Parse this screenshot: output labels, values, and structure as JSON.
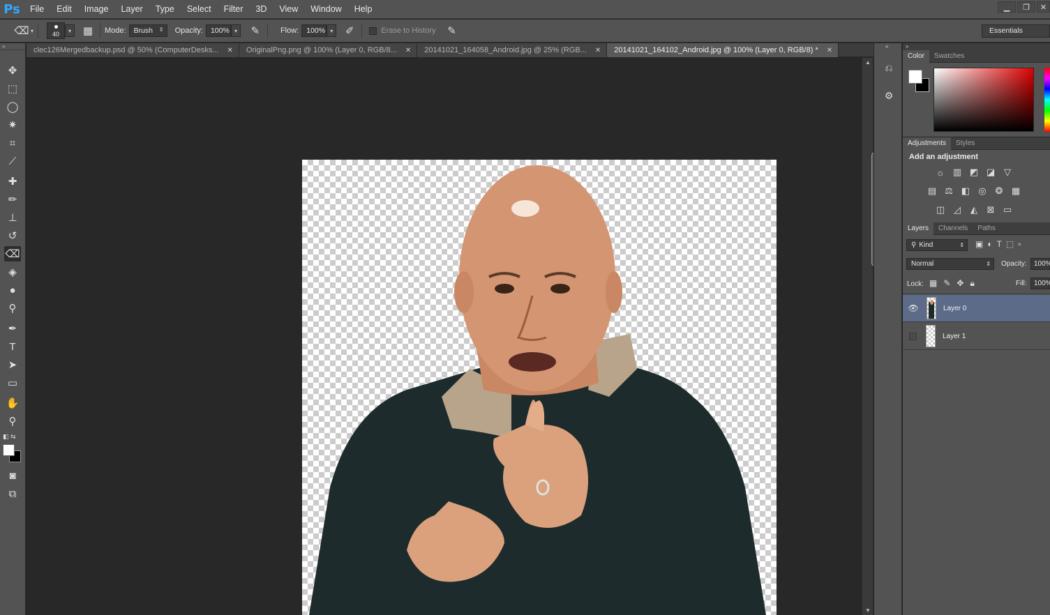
{
  "app": {
    "logo": "Ps",
    "menu": [
      "File",
      "Edit",
      "Image",
      "Layer",
      "Type",
      "Select",
      "Filter",
      "3D",
      "View",
      "Window",
      "Help"
    ]
  },
  "options_bar": {
    "brush_size": "40",
    "mode_label": "Mode:",
    "mode_value": "Brush",
    "opacity_label": "Opacity:",
    "opacity_value": "100%",
    "flow_label": "Flow:",
    "flow_value": "100%",
    "erase_history_label": "Erase to History",
    "workspace": "Essentials"
  },
  "tabs": [
    {
      "label": "clec126Mergedbackup.psd @ 50% (ComputerDesks...",
      "active": false
    },
    {
      "label": "OriginalPng.png @ 100% (Layer 0, RGB/8...",
      "active": false
    },
    {
      "label": "20141021_164058_Android.jpg @ 25% (RGB...",
      "active": false
    },
    {
      "label": "20141021_164102_Android.jpg @ 100% (Layer 0, RGB/8) *",
      "active": true
    }
  ],
  "color_panel": {
    "tabs": [
      "Color",
      "Swatches"
    ],
    "foreground": "#ffffff",
    "background": "#000000",
    "hue_color": "#e00000"
  },
  "adjustments_panel": {
    "tabs": [
      "Adjustments",
      "Styles"
    ],
    "title": "Add an adjustment",
    "icons_row1": [
      "brightness-contrast-icon",
      "levels-icon",
      "curves-icon",
      "exposure-icon",
      "vibrance-icon"
    ],
    "icons_row2": [
      "hue-saturation-icon",
      "color-balance-icon",
      "black-white-icon",
      "photo-filter-icon",
      "channel-mixer-icon",
      "color-lookup-icon"
    ],
    "icons_row3": [
      "invert-icon",
      "posterize-icon",
      "threshold-icon",
      "selective-color-icon",
      "gradient-map-icon"
    ]
  },
  "layers_panel": {
    "tabs": [
      "Layers",
      "Channels",
      "Paths"
    ],
    "filter_label": "Kind",
    "blend_mode": "Normal",
    "opacity_label": "Opacity:",
    "opacity_value": "100%",
    "lock_label": "Lock:",
    "fill_label": "Fill:",
    "fill_value": "100%",
    "layers": [
      {
        "name": "Layer 0",
        "visible": true,
        "selected": true
      },
      {
        "name": "Layer 1",
        "visible": false,
        "selected": false
      }
    ]
  }
}
